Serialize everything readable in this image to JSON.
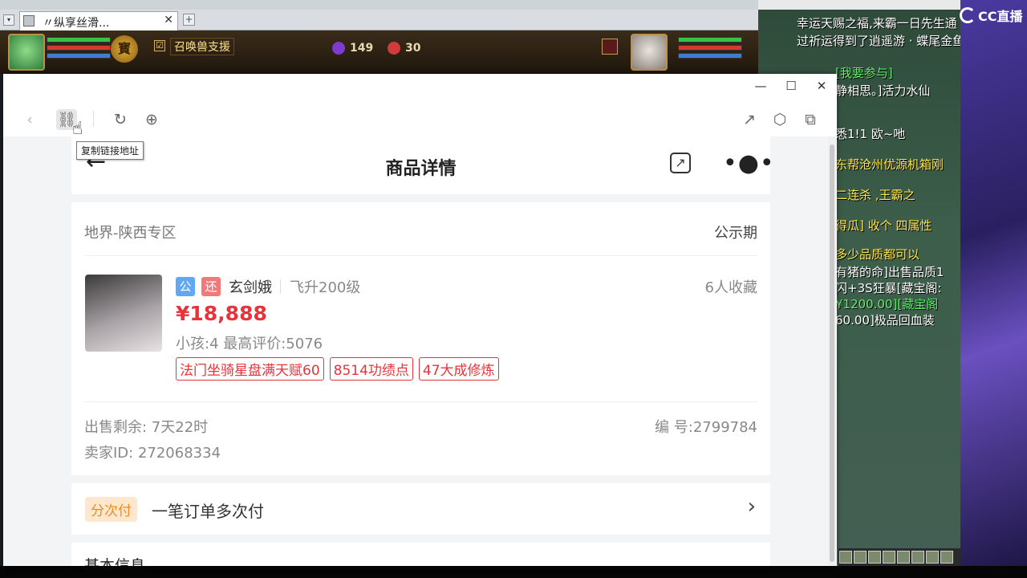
{
  "game": {
    "tab_title": "〃纵享丝滑...",
    "tab_close": "✕",
    "tab_new": "+",
    "treasure_label": "寳",
    "summon_checkbox": "☑",
    "summon_label": "召唤兽支援",
    "stat_a": "149",
    "stat_b": "30"
  },
  "chat": {
    "lines": [
      {
        "text": "幸运天赐之福,来霸一日先生通",
        "color": "#ffffff"
      },
      {
        "text": "过祈运得到了逍遥游 · 蝶尾金鱼",
        "color": "#ffffff"
      },
      {
        "text": "[我要参与]",
        "color": "#5ef06a"
      },
      {
        "text": "静相思。]活力水仙",
        "color": "#ffffff"
      },
      {
        "text": "悉1!1 欧~吔",
        "color": "#ffffff"
      },
      {
        "text": "东帮沧州优源机箱刚",
        "color": "#ffe64a"
      },
      {
        "text": "二连杀 ,王霸之",
        "color": "#ffe64a"
      },
      {
        "text": "得瓜] 收个 四属性",
        "color": "#ffe64a"
      },
      {
        "text": "多少品质都可以",
        "color": "#ffe64a"
      },
      {
        "text": "有猪的命]出售品质1",
        "color": "#ffffff"
      },
      {
        "text": "闪+3S狂暴[藏宝阁:",
        "color": "#ffffff"
      },
      {
        "text": "¥1200.00][藏宝阁",
        "color": "#5ef06a"
      },
      {
        "text": "60.00]极品回血装",
        "color": "#ffffff"
      }
    ]
  },
  "stream_logo": "CC直播",
  "browser": {
    "controls": {
      "minimize": "—",
      "maximize": "☐",
      "close": "✕"
    },
    "tooltip": "复制链接地址",
    "icons": {
      "back": "‹",
      "link": "⛓",
      "reload": "↻",
      "globe": "⊕",
      "share": "↗",
      "box": "⬡",
      "ext": "⧉"
    }
  },
  "page": {
    "header": {
      "back": "←",
      "title": "商品详情",
      "share": "↗",
      "more": "•●•"
    },
    "region": "地界-陕西专区",
    "period": "公示期",
    "badges": {
      "public": "公",
      "return": "还"
    },
    "role_name": "玄剑娥",
    "role_level": "飞升200级",
    "favorites": "6人收藏",
    "price": "¥18,888",
    "kids": "小孩:4 最高评价:5076",
    "tags": [
      "法门坐骑星盘满天赋60",
      "8514功绩点",
      "47大成修炼"
    ],
    "remain": "出售剩余: 7天22时",
    "serial": "编 号:2799784",
    "seller": "卖家ID: 272068334",
    "pay_badge": "分次付",
    "pay_text": "一笔订单多次付",
    "pay_chevron": "›",
    "basic_info": "基本信息"
  },
  "colors": {
    "price": "#e8333a",
    "badge_public": "#5fa8f5",
    "badge_return": "#f07a7a",
    "pay_badge_text": "#f08c1e"
  }
}
